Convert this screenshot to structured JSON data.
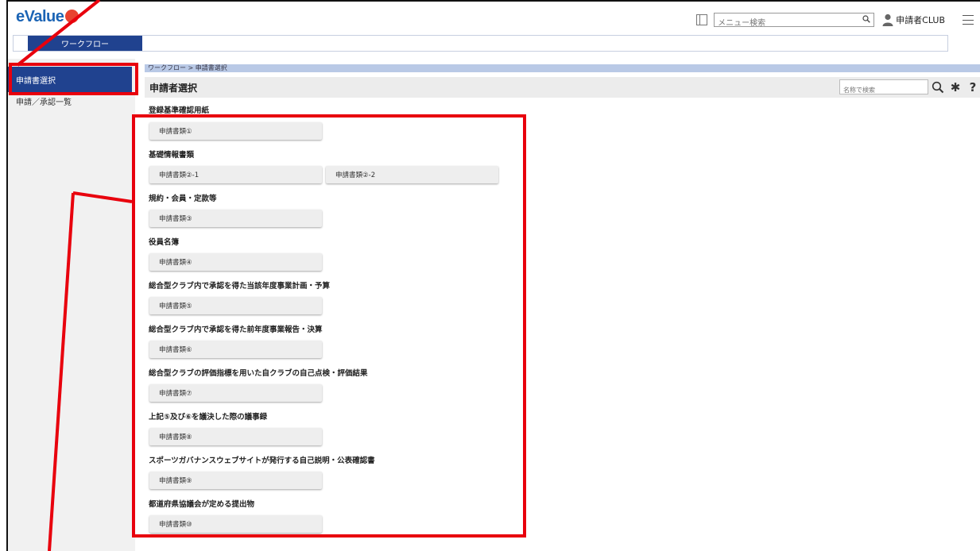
{
  "header": {
    "logo_text": "eValue",
    "menu_search_placeholder": "メニュー検索",
    "user_label": "申請者CLUB"
  },
  "nav": {
    "tab_label": "ワークフロー"
  },
  "sidebar": {
    "items": [
      {
        "label": "申請書選択"
      },
      {
        "label": "申請／承認一覧"
      }
    ]
  },
  "main": {
    "breadcrumb": "ワークフロー > 申請書選択",
    "title": "申請者選択",
    "name_search_placeholder": "名称で検索",
    "sections": [
      {
        "title": "登録基準確認用紙",
        "buttons": [
          "申請書類①"
        ]
      },
      {
        "title": "基礎情報書類",
        "buttons": [
          "申請書類②-1",
          "申請書類②-2"
        ]
      },
      {
        "title": "規約・会員・定款等",
        "buttons": [
          "申請書類③"
        ]
      },
      {
        "title": "役員名簿",
        "buttons": [
          "申請書類④"
        ]
      },
      {
        "title": "総合型クラブ内で承認を得た当該年度事業計画・予算",
        "buttons": [
          "申請書類⑤"
        ]
      },
      {
        "title": "総合型クラブ内で承認を得た前年度事業報告・決算",
        "buttons": [
          "申請書類⑥"
        ]
      },
      {
        "title": "総合型クラブの評価指標を用いた自クラブの自己点検・評価結果",
        "buttons": [
          "申請書類⑦"
        ]
      },
      {
        "title": "上記⑤及び⑥を議決した際の議事録",
        "buttons": [
          "申請書類⑧"
        ]
      },
      {
        "title": "スポーツガバナンスウェブサイトが発行する自己説明・公表確認書",
        "buttons": [
          "申請書類⑨"
        ]
      },
      {
        "title": "都道府県協議会が定める提出物",
        "buttons": [
          "申請書類⑩"
        ]
      }
    ]
  },
  "colors": {
    "nav_blue": "#20428f",
    "breadcrumb_blue": "#b9c9e6",
    "annotation_red": "#e8000d",
    "logo_blue": "#1b64b5",
    "logo_red": "#e8422f"
  }
}
